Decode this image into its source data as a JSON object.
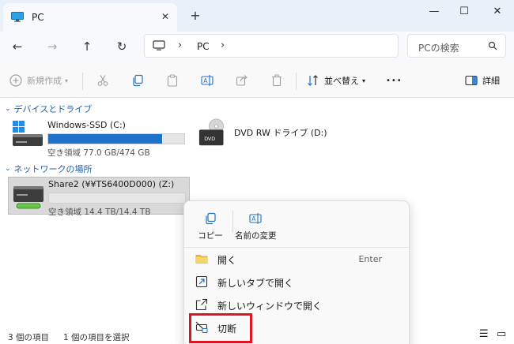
{
  "tab": {
    "title": "PC",
    "close_glyph": "✕",
    "new_tab_glyph": "+"
  },
  "window_controls": {
    "minimize": "—",
    "maximize": "☐",
    "close": "✕"
  },
  "address": {
    "separator": "›",
    "crumb": "PC"
  },
  "search": {
    "placeholder": "PCの検索"
  },
  "toolbar": {
    "new_label": "新規作成",
    "sort_label": "並べ替え",
    "more_label": "•••",
    "details_label": "詳細"
  },
  "groups": {
    "devices": "デバイスとドライブ",
    "network": "ネットワークの場所"
  },
  "drives": {
    "windows": {
      "name": "Windows-SSD (C:)",
      "free": "空き領域 77.0 GB/474 GB",
      "used_fraction": 0.84
    },
    "dvd": {
      "name": "DVD RW ドライブ (D:)",
      "label": "DVD"
    },
    "share": {
      "name": "Share2 (¥¥TS6400D000) (Z:)",
      "free": "空き領域 14.4 TB/14.4 TB",
      "used_fraction": 0.0
    }
  },
  "status": {
    "count": "3 個の項目",
    "selected": "1 個の項目を選択"
  },
  "context_menu": {
    "copy": "コピー",
    "rename": "名前の変更",
    "open": "開く",
    "open_shortcut": "Enter",
    "open_new_tab": "新しいタブで開く",
    "open_new_window": "新しいウィンドウで開く",
    "disconnect": "切断"
  },
  "colors": {
    "accent": "#1f72c9",
    "highlight": "#e0141e",
    "group": "#1f5fa8"
  }
}
